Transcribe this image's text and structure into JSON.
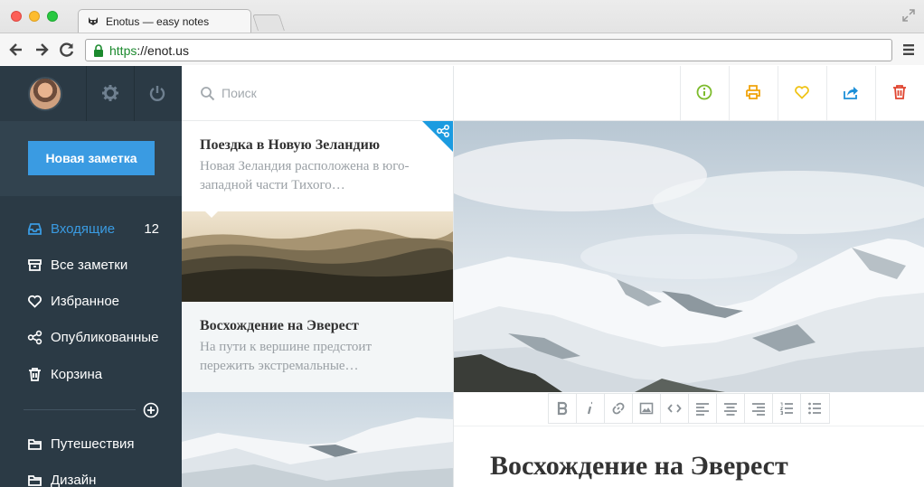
{
  "browser": {
    "tab_title": "Enotus — easy notes",
    "url_scheme": "https",
    "url_rest": "://enot.us"
  },
  "sidebar": {
    "new_note_label": "Новая заметка",
    "items": [
      {
        "label": "Входящие",
        "count": "12",
        "icon": "inbox-icon",
        "active": true
      },
      {
        "label": "Все заметки",
        "icon": "archive-icon"
      },
      {
        "label": "Избранное",
        "icon": "heart-icon"
      },
      {
        "label": "Опубликованные",
        "icon": "share-icon"
      },
      {
        "label": "Корзина",
        "icon": "trash-icon"
      }
    ],
    "folders": [
      {
        "label": "Путешествия",
        "icon": "folder-icon"
      },
      {
        "label": "Дизайн",
        "icon": "folder-icon"
      }
    ]
  },
  "search": {
    "placeholder": "Поиск"
  },
  "notes": [
    {
      "title": "Поездка в Новую Зеландию",
      "snippet": "Новая Зеландия расположена в юго-западной части Тихого…",
      "shared": true
    },
    {
      "title": "Восхождение на Эверест",
      "snippet": "На пути к вершине предстоит пережить экстремальные…",
      "shared": false
    }
  ],
  "editor": {
    "title": "Восхождение на Эверест",
    "actions": [
      "info-icon",
      "print-icon",
      "heart-icon",
      "share-icon",
      "trash-icon"
    ],
    "format_buttons": [
      "bold-icon",
      "italic-icon",
      "link-icon",
      "image-icon",
      "code-icon",
      "align-left-icon",
      "align-center-icon",
      "align-right-icon",
      "ordered-list-icon",
      "bullet-list-icon"
    ]
  },
  "colors": {
    "accent": "#3a9be2",
    "sidebar": "#2b3a45",
    "info": "#7dbb2c",
    "print": "#f0a30a",
    "favorite": "#f0c419",
    "share": "#1c8fd8",
    "delete": "#e0442f"
  }
}
